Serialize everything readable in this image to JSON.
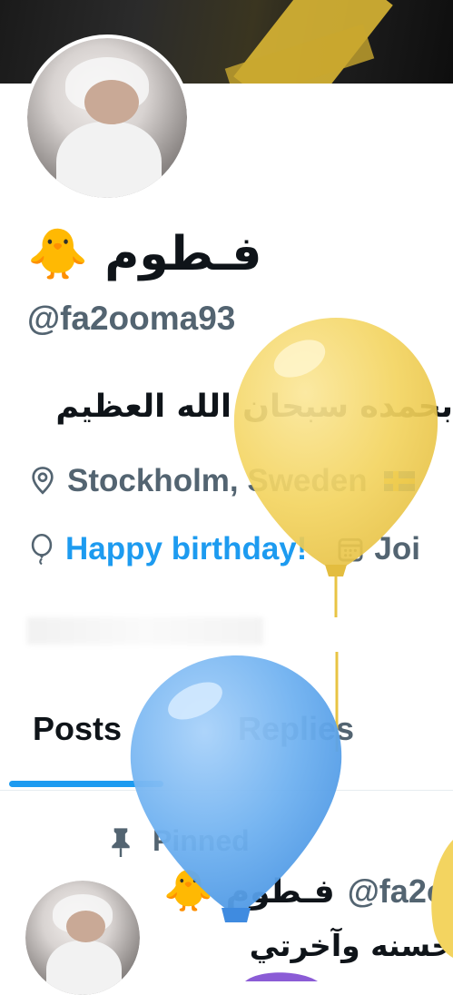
{
  "profile": {
    "display_name": "فـطوم",
    "name_emoji": "🐥",
    "handle": "@fa2ooma93",
    "bio": "بحمده سبحان الله العظيم",
    "location": "Stockholm, Sweden",
    "birthday": "Happy birthday!",
    "joined_partial": "Joi"
  },
  "tabs": [
    {
      "label": "Posts"
    },
    {
      "label": "Replies"
    }
  ],
  "pinned_label": "Pinned",
  "tweet": {
    "author_name": "فـطوم",
    "author_emoji": "🐥",
    "author_handle_partial": "@fa2o",
    "text_partial": "حسنه وآخرتي"
  },
  "colors": {
    "accent": "#1d9bf0",
    "secondary_text": "#536471",
    "balloon_yellow": "#f3d460",
    "balloon_blue": "#6fb1f0"
  },
  "icons": {
    "location": "map-pin-icon",
    "birthday": "balloon-icon",
    "joined": "calendar-icon",
    "pinned": "pin-icon"
  }
}
